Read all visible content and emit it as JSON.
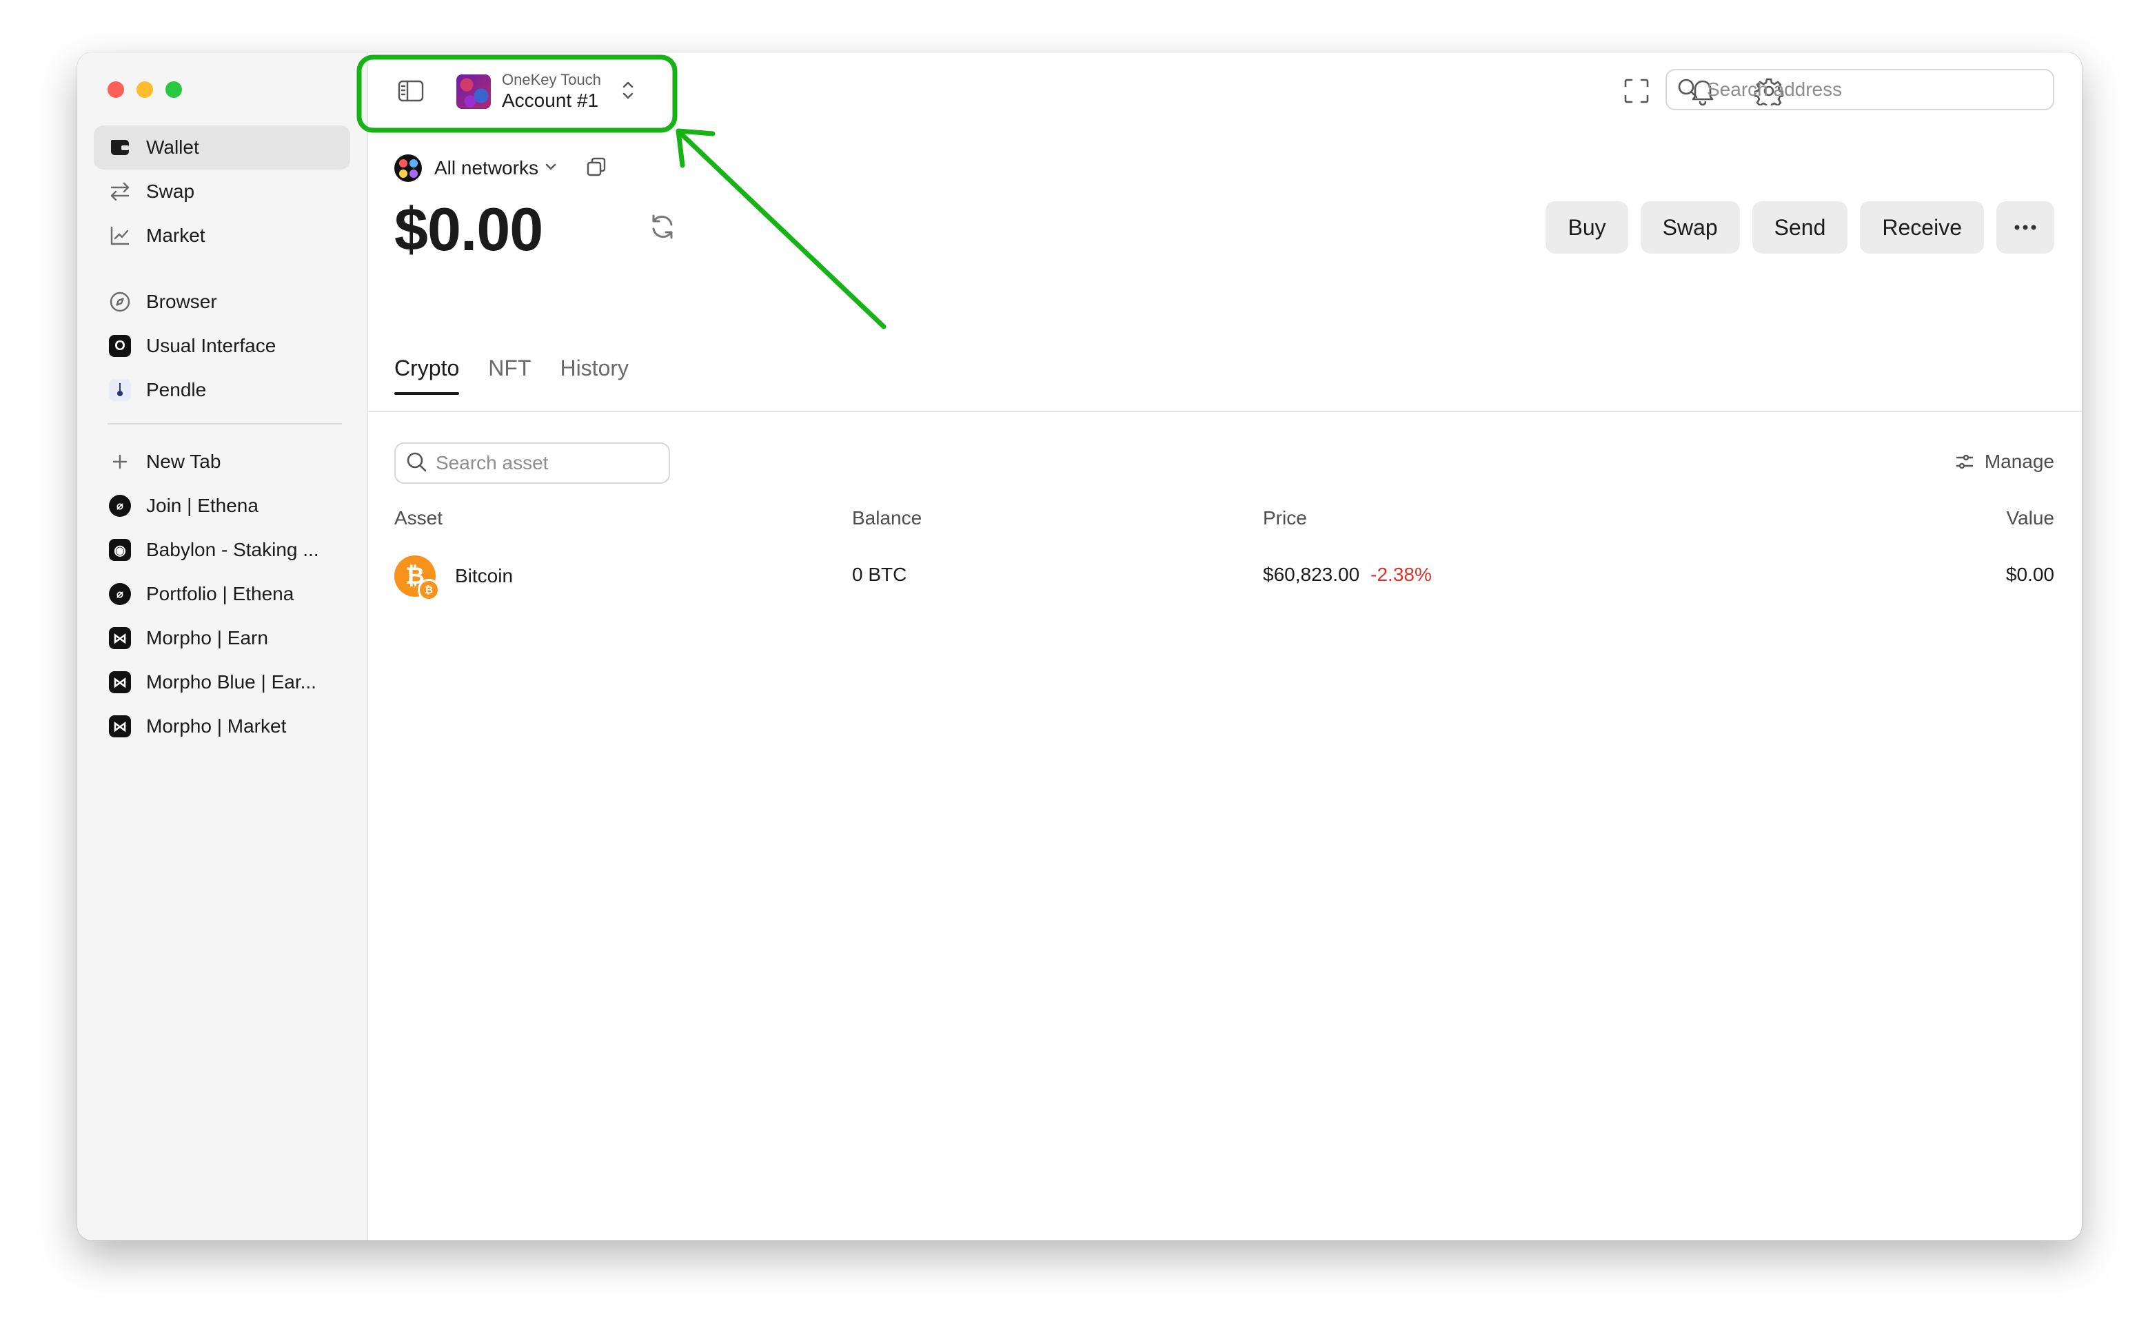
{
  "window": {
    "traffic_lights": {
      "close": "#fe5f57",
      "minimize": "#febc2e",
      "zoom": "#28c840"
    }
  },
  "sidebar": {
    "primary": [
      {
        "label": "Wallet",
        "icon": "wallet-icon",
        "active": true
      },
      {
        "label": "Swap",
        "icon": "swap-icon"
      },
      {
        "label": "Market",
        "icon": "market-chart-icon"
      }
    ],
    "pinned": [
      {
        "label": "Browser",
        "icon": "compass-icon"
      },
      {
        "label": "Usual Interface",
        "icon": "usual-favicon"
      },
      {
        "label": "Pendle",
        "icon": "pendle-favicon"
      }
    ],
    "tabs": [
      {
        "label": "New Tab",
        "icon": "plus-icon"
      },
      {
        "label": "Join | Ethena",
        "icon": "ethena-favicon"
      },
      {
        "label": "Babylon - Staking ...",
        "icon": "babylon-favicon"
      },
      {
        "label": "Portfolio | Ethena",
        "icon": "ethena-favicon"
      },
      {
        "label": "Morpho | Earn",
        "icon": "morpho-favicon"
      },
      {
        "label": "Morpho Blue | Ear...",
        "icon": "morpho-favicon"
      },
      {
        "label": "Morpho | Market",
        "icon": "morpho-favicon"
      }
    ]
  },
  "header": {
    "device_name": "OneKey Touch",
    "account_name": "Account #1",
    "search_placeholder": "Search address",
    "icons": [
      "sidebar-toggle-icon",
      "expand-icon",
      "bell-icon",
      "gear-icon",
      "search-icon"
    ]
  },
  "account": {
    "network_label": "All networks",
    "balance": "$0.00",
    "actions": [
      "Buy",
      "Swap",
      "Send",
      "Receive"
    ]
  },
  "tabs": [
    "Crypto",
    "NFT",
    "History"
  ],
  "assets": {
    "search_placeholder": "Search asset",
    "manage_label": "Manage",
    "columns": [
      "Asset",
      "Balance",
      "Price",
      "Value"
    ],
    "rows": [
      {
        "name": "Bitcoin",
        "balance": "0 BTC",
        "price": "$60,823.00",
        "change": "-2.38%",
        "value": "$0.00"
      }
    ]
  },
  "colors": {
    "highlight": "#15b315",
    "negative_change": "#d9342b",
    "bitcoin": "#f7931a"
  }
}
